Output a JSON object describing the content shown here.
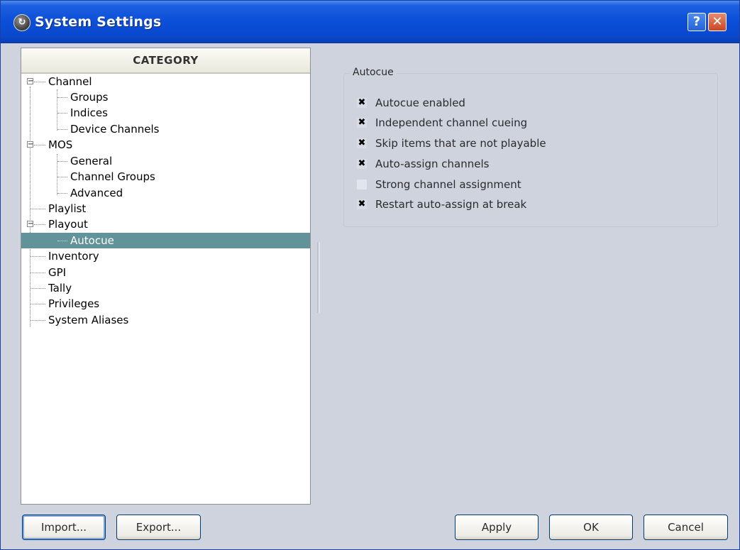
{
  "window": {
    "title": "System Settings",
    "help_label": "?",
    "close_label": "✕",
    "app_icon_glyph": "↻"
  },
  "tree": {
    "header": "CATEGORY",
    "items": [
      {
        "label": "Channel",
        "expander": "−"
      },
      {
        "label": "Groups"
      },
      {
        "label": "Indices"
      },
      {
        "label": "Device Channels"
      },
      {
        "label": "MOS",
        "expander": "−"
      },
      {
        "label": "General"
      },
      {
        "label": "Channel Groups"
      },
      {
        "label": "Advanced"
      },
      {
        "label": "Playlist"
      },
      {
        "label": "Playout",
        "expander": "−"
      },
      {
        "label": "Autocue",
        "selected": true
      },
      {
        "label": "Inventory"
      },
      {
        "label": "GPI"
      },
      {
        "label": "Tally"
      },
      {
        "label": "Privileges"
      },
      {
        "label": "System Aliases"
      }
    ]
  },
  "autocue": {
    "group_title": "Autocue",
    "options": [
      {
        "label": "Autocue enabled",
        "checked": true,
        "mark": "✖"
      },
      {
        "label": "Independent channel cueing",
        "checked": true,
        "mark": "✖"
      },
      {
        "label": "Skip items that are not playable",
        "checked": true,
        "mark": "✖"
      },
      {
        "label": "Auto-assign channels",
        "checked": true,
        "mark": "✖"
      },
      {
        "label": "Strong channel assignment",
        "checked": false,
        "mark": ""
      },
      {
        "label": "Restart auto-assign at break",
        "checked": true,
        "mark": "✖"
      }
    ]
  },
  "buttons": {
    "import": "Import...",
    "export": "Export...",
    "apply": "Apply",
    "ok": "OK",
    "cancel": "Cancel"
  }
}
